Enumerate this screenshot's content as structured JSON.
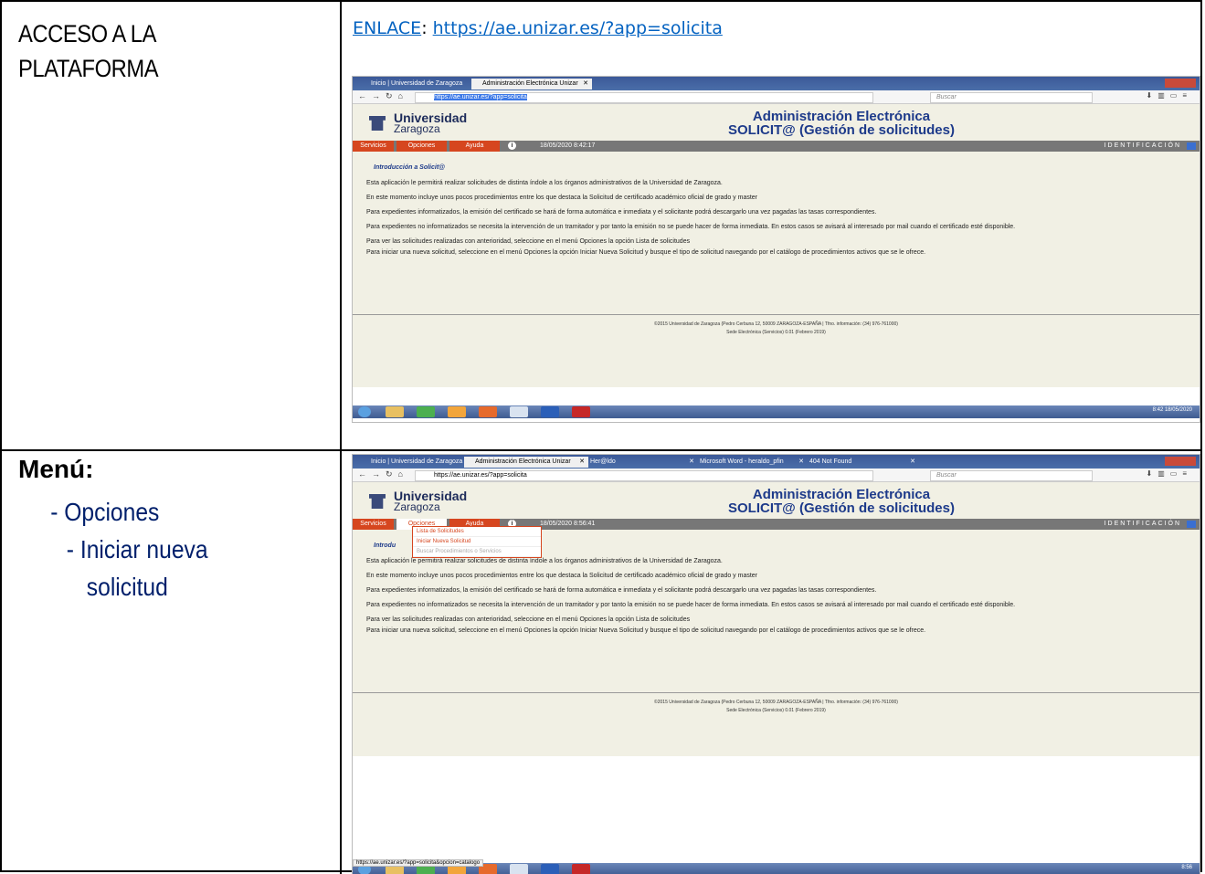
{
  "row1": {
    "left_heading_line1": "ACCESO A LA",
    "left_heading_line2": "PLATAFORMA",
    "link_label": "ENLACE",
    "link_sep": ": ",
    "link_url": "https://ae.unizar.es/?app=solicita"
  },
  "row2": {
    "menu_title": "Menú:",
    "item1": "- Opciones",
    "item2": "-  Iniciar nueva",
    "item3": "solicitud"
  },
  "browser1": {
    "tabs": [
      "Inicio | Universidad de Zaragoza",
      "Administración Electrónica Unizar"
    ],
    "url": "https://ae.unizar.es/?app=solicita",
    "search_placeholder": "Buscar",
    "datetime": "18/05/2020 8:42:17",
    "clock": "8:42",
    "clock_date": "18/05/2020"
  },
  "browser2": {
    "tabs": [
      "Inicio | Universidad de Zaragoza",
      "Administración Electrónica Unizar",
      "Her@ldo",
      "Microsoft Word - heraldo_pfin",
      "404 Not Found"
    ],
    "url": "https://ae.unizar.es/?app=solicita",
    "search_placeholder": "Buscar",
    "datetime": "18/05/2020 8:56:41",
    "clock": "8:56",
    "dropdown": [
      "Lista de Solicitudes",
      "Iniciar Nueva Solicitud",
      "Buscar Procedimientos o Servicios"
    ],
    "status_url": "https://ae.unizar.es/?app=solicita&opcion=catalogo"
  },
  "site": {
    "logo_line1": "Universidad",
    "logo_line2": "Zaragoza",
    "title_line1": "Administración Electrónica",
    "title_line2": "SOLICIT@ (Gestión de solicitudes)",
    "nav": [
      "Servicios",
      "Opciones",
      "Ayuda"
    ],
    "identificacion": "IDENTIFICACIÓN",
    "intro": "Introducción a Solicit@",
    "intro_cut": "Introdu",
    "p1": "Esta aplicación le permitirá realizar solicitudes de distinta índole a los órganos administrativos de la Universidad de Zaragoza.",
    "p2": "En este momento incluye unos pocos procedimientos entre los que destaca la Solicitud de certificado académico oficial de grado y master",
    "p3": "Para expedientes informatizados, la emisión del certificado se hará de forma automática e inmediata y el solicitante podrá descargarlo una vez pagadas las tasas correspondientes.",
    "p4": "Para expedientes no informatizados se necesita la intervención de un tramitador y por tanto la emisión no se puede hacer de forma inmediata. En estos casos se avisará al interesado por mail cuando el certificado esté disponible.",
    "p5": "Para ver las solicitudes realizadas con anterioridad, seleccione en el menú Opciones la opción Lista de solicitudes",
    "p6": "Para iniciar una nueva solicitud, seleccione en el menú Opciones la opción Iniciar Nueva Solicitud y busque el tipo de solicitud navegando por el catálogo de procedimientos activos que se le ofrece.",
    "footer1": "©2015 Universidad de Zaragoza (Pedro Cerbuna 12, 50009 ZARAGOZA-ESPAÑA | Tfno. información: (34) 976-761000)",
    "footer2": "Sede Electrónica (Servicios) 0.01 (Febrero 2019)"
  }
}
